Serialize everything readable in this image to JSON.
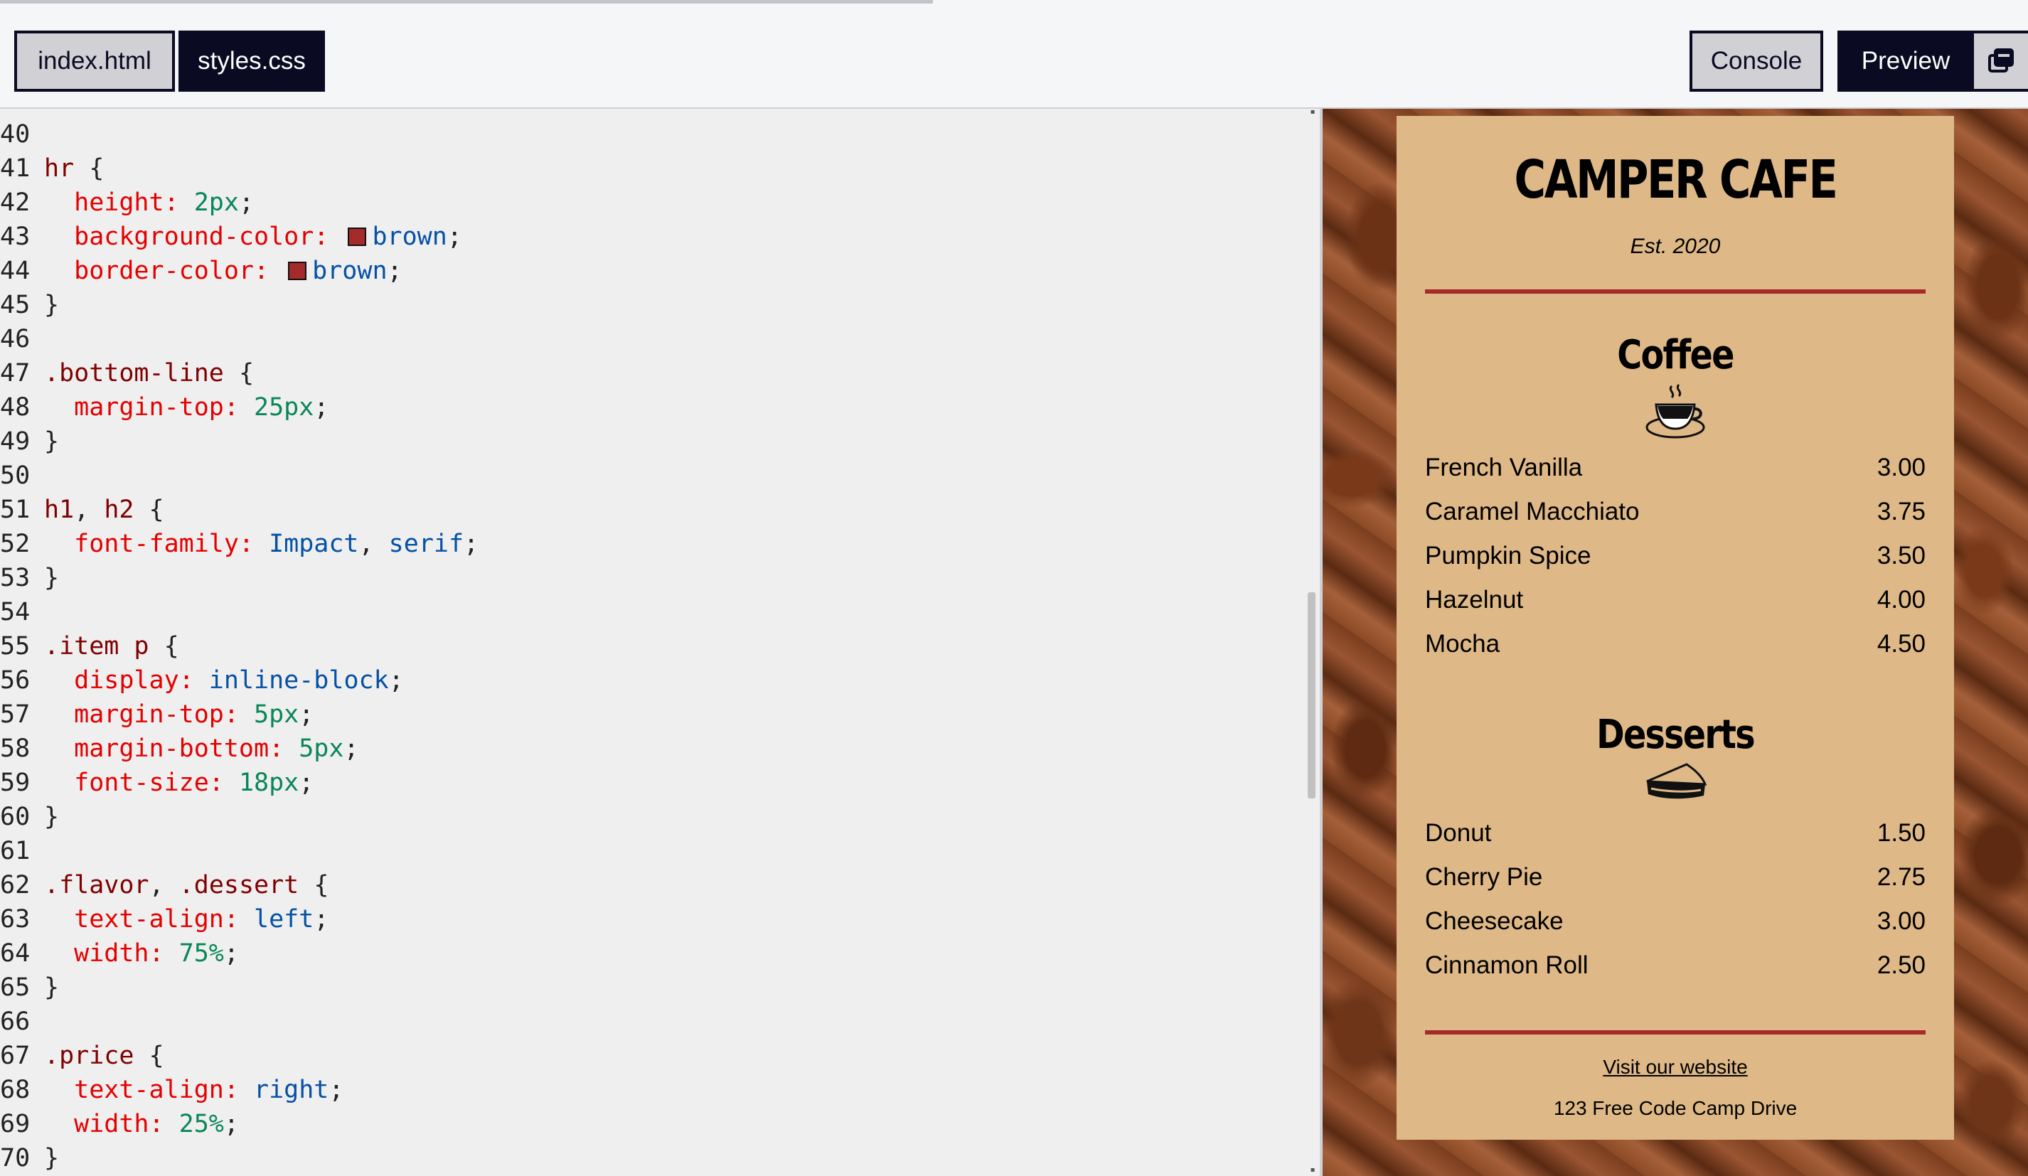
{
  "toolbar": {
    "file_tabs": [
      "index.html",
      "styles.css"
    ],
    "console_label": "Console",
    "preview_label": "Preview",
    "popout_icon": "popout-window-icon",
    "progress_fraction": 0.46
  },
  "editor": {
    "lines": [
      {
        "n": "40",
        "tokens": []
      },
      {
        "n": "41",
        "tokens": [
          {
            "t": "hr",
            "c": "sel"
          },
          {
            "t": " {",
            "c": "punc"
          }
        ]
      },
      {
        "n": "42",
        "tokens": [
          {
            "t": "  height: ",
            "c": "prop"
          },
          {
            "t": "2px",
            "c": "num"
          },
          {
            "t": ";",
            "c": "punc"
          }
        ]
      },
      {
        "n": "43",
        "tokens": [
          {
            "t": "  background-color: ",
            "c": "prop"
          },
          {
            "swatch": "#a52a2a"
          },
          {
            "t": "brown",
            "c": "val"
          },
          {
            "t": ";",
            "c": "punc"
          }
        ]
      },
      {
        "n": "44",
        "tokens": [
          {
            "t": "  border-color: ",
            "c": "prop"
          },
          {
            "swatch": "#a52a2a"
          },
          {
            "t": "brown",
            "c": "val"
          },
          {
            "t": ";",
            "c": "punc"
          }
        ]
      },
      {
        "n": "45",
        "tokens": [
          {
            "t": "}",
            "c": "punc"
          }
        ]
      },
      {
        "n": "46",
        "tokens": []
      },
      {
        "n": "47",
        "tokens": [
          {
            "t": ".bottom-line",
            "c": "sel"
          },
          {
            "t": " {",
            "c": "punc"
          }
        ]
      },
      {
        "n": "48",
        "tokens": [
          {
            "t": "  margin-top: ",
            "c": "prop"
          },
          {
            "t": "25px",
            "c": "num"
          },
          {
            "t": ";",
            "c": "punc"
          }
        ]
      },
      {
        "n": "49",
        "tokens": [
          {
            "t": "}",
            "c": "punc"
          }
        ]
      },
      {
        "n": "50",
        "tokens": []
      },
      {
        "n": "51",
        "tokens": [
          {
            "t": "h1",
            "c": "sel"
          },
          {
            "t": ", ",
            "c": "punc"
          },
          {
            "t": "h2",
            "c": "sel"
          },
          {
            "t": " {",
            "c": "punc"
          }
        ]
      },
      {
        "n": "52",
        "tokens": [
          {
            "t": "  font-family: ",
            "c": "prop"
          },
          {
            "t": "Impact",
            "c": "val"
          },
          {
            "t": ", ",
            "c": "punc"
          },
          {
            "t": "serif",
            "c": "val"
          },
          {
            "t": ";",
            "c": "punc"
          }
        ]
      },
      {
        "n": "53",
        "tokens": [
          {
            "t": "}",
            "c": "punc"
          }
        ]
      },
      {
        "n": "54",
        "tokens": []
      },
      {
        "n": "55",
        "tokens": [
          {
            "t": ".item p",
            "c": "sel"
          },
          {
            "t": " {",
            "c": "punc"
          }
        ]
      },
      {
        "n": "56",
        "tokens": [
          {
            "t": "  display: ",
            "c": "prop"
          },
          {
            "t": "inline-block",
            "c": "val"
          },
          {
            "t": ";",
            "c": "punc"
          }
        ]
      },
      {
        "n": "57",
        "tokens": [
          {
            "t": "  margin-top: ",
            "c": "prop"
          },
          {
            "t": "5px",
            "c": "num"
          },
          {
            "t": ";",
            "c": "punc"
          }
        ]
      },
      {
        "n": "58",
        "tokens": [
          {
            "t": "  margin-bottom: ",
            "c": "prop"
          },
          {
            "t": "5px",
            "c": "num"
          },
          {
            "t": ";",
            "c": "punc"
          }
        ]
      },
      {
        "n": "59",
        "tokens": [
          {
            "t": "  font-size: ",
            "c": "prop"
          },
          {
            "t": "18px",
            "c": "num"
          },
          {
            "t": ";",
            "c": "punc"
          }
        ]
      },
      {
        "n": "60",
        "tokens": [
          {
            "t": "}",
            "c": "punc"
          }
        ]
      },
      {
        "n": "61",
        "tokens": []
      },
      {
        "n": "62",
        "tokens": [
          {
            "t": ".flavor",
            "c": "sel"
          },
          {
            "t": ", ",
            "c": "punc"
          },
          {
            "t": ".dessert",
            "c": "sel"
          },
          {
            "t": " {",
            "c": "punc"
          }
        ]
      },
      {
        "n": "63",
        "tokens": [
          {
            "t": "  text-align: ",
            "c": "prop"
          },
          {
            "t": "left",
            "c": "val"
          },
          {
            "t": ";",
            "c": "punc"
          }
        ]
      },
      {
        "n": "64",
        "tokens": [
          {
            "t": "  width: ",
            "c": "prop"
          },
          {
            "t": "75%",
            "c": "num"
          },
          {
            "t": ";",
            "c": "punc"
          }
        ]
      },
      {
        "n": "65",
        "tokens": [
          {
            "t": "}",
            "c": "punc"
          }
        ]
      },
      {
        "n": "66",
        "tokens": []
      },
      {
        "n": "67",
        "tokens": [
          {
            "t": ".price",
            "c": "sel"
          },
          {
            "t": " {",
            "c": "punc"
          }
        ]
      },
      {
        "n": "68",
        "tokens": [
          {
            "t": "  text-align: ",
            "c": "prop"
          },
          {
            "t": "right",
            "c": "val"
          },
          {
            "t": ";",
            "c": "punc"
          }
        ]
      },
      {
        "n": "69",
        "tokens": [
          {
            "t": "  width: ",
            "c": "prop"
          },
          {
            "t": "25%",
            "c": "num"
          },
          {
            "t": ";",
            "c": "punc"
          }
        ]
      },
      {
        "n": "70",
        "tokens": [
          {
            "t": "}",
            "c": "punc"
          }
        ]
      }
    ]
  },
  "preview": {
    "title": "CAMPER CAFE",
    "established": "Est. 2020",
    "accent_color": "#a52a2a",
    "menu_bg": "#deb887",
    "coffee": {
      "title": "Coffee",
      "icon": "coffee-cup-icon",
      "items": [
        {
          "name": "French Vanilla",
          "price": "3.00"
        },
        {
          "name": "Caramel Macchiato",
          "price": "3.75"
        },
        {
          "name": "Pumpkin Spice",
          "price": "3.50"
        },
        {
          "name": "Hazelnut",
          "price": "4.00"
        },
        {
          "name": "Mocha",
          "price": "4.50"
        }
      ]
    },
    "desserts": {
      "title": "Desserts",
      "icon": "pie-slice-icon",
      "items": [
        {
          "name": "Donut",
          "price": "1.50"
        },
        {
          "name": "Cherry Pie",
          "price": "2.75"
        },
        {
          "name": "Cheesecake",
          "price": "3.00"
        },
        {
          "name": "Cinnamon Roll",
          "price": "2.50"
        }
      ]
    },
    "footer": {
      "link_text": "Visit our website",
      "address": "123 Free Code Camp Drive"
    }
  }
}
